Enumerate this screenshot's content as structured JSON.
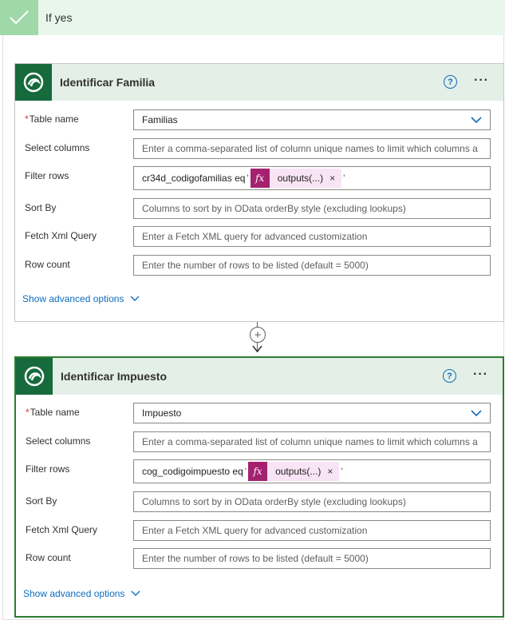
{
  "branch": {
    "title": "If yes"
  },
  "cards": [
    {
      "title": "Identificar Familia",
      "table_name_label": "Table name",
      "table_name_value": "Familias",
      "select_columns_label": "Select columns",
      "select_columns_placeholder": "Enter a comma-separated list of column unique names to limit which columns a",
      "filter_rows_label": "Filter rows",
      "filter_prefix": "cr34d_codigofamilias eq",
      "filter_token": "outputs(...)",
      "sort_by_label": "Sort By",
      "sort_by_placeholder": "Columns to sort by in OData orderBy style (excluding lookups)",
      "fetch_xml_label": "Fetch Xml Query",
      "fetch_xml_placeholder": "Enter a Fetch XML query for advanced customization",
      "row_count_label": "Row count",
      "row_count_placeholder": "Enter the number of rows to be listed (default = 5000)",
      "advanced_label": "Show advanced options"
    },
    {
      "title": "Identificar Impuesto",
      "table_name_label": "Table name",
      "table_name_value": "Impuesto",
      "select_columns_label": "Select columns",
      "select_columns_placeholder": "Enter a comma-separated list of column unique names to limit which columns a",
      "filter_rows_label": "Filter rows",
      "filter_prefix": "cog_codigoimpuesto eq",
      "filter_token": "outputs(...)",
      "sort_by_label": "Sort By",
      "sort_by_placeholder": "Columns to sort by in OData orderBy style (excluding lookups)",
      "fetch_xml_label": "Fetch Xml Query",
      "fetch_xml_placeholder": "Enter a Fetch XML query for advanced customization",
      "row_count_label": "Row count",
      "row_count_placeholder": "Enter the number of rows to be listed (default = 5000)",
      "advanced_label": "Show advanced options"
    }
  ],
  "symbols": {
    "required": "*",
    "quote": "'",
    "help": "?",
    "more": "···",
    "fx": "fx",
    "remove": "×",
    "plus": "+"
  },
  "icons": [
    "checkmark-icon",
    "dataverse-logo-icon",
    "help-icon",
    "more-options-icon",
    "chevron-down-icon",
    "fx-icon",
    "close-icon",
    "add-step-icon",
    "arrow-down-icon"
  ],
  "colors": {
    "brand": "#166a3c",
    "link": "#0f6cbd",
    "expression": "#a4216f",
    "focus": "#2e7d32",
    "branch": "#9fd8a9"
  }
}
